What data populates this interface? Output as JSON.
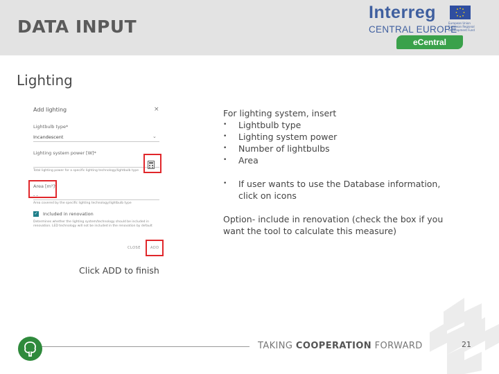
{
  "header": {
    "title": "DATA INPUT",
    "logo": {
      "line1": "Interreg",
      "line2": "CENTRAL EUROPE",
      "eu_text": "European Union European Regional Development Fund",
      "badge": "eCentral"
    }
  },
  "subtitle": "Lighting",
  "dialog": {
    "title": "Add lighting",
    "close_glyph": "×",
    "bulb_type_label": "Lightbulb type*",
    "bulb_type_value": "Incandescent",
    "power_label": "Lighting system power [W]*",
    "power_help": "Total lighting power for a specific lighting technology/lightbulb type",
    "area_label": "Area [m²]*",
    "area_value": "- -",
    "area_help": "Area covered by the specific lighting technology/lightbulb type",
    "include_label": "Included in renovation",
    "include_help": "Determines whether the lighting system/technology should be included in renovation. LED technology will not be included in the renovation by default",
    "close_button": "CLOSE",
    "add_button": "ADD"
  },
  "instructions": {
    "intro": "For lighting system, insert",
    "items": [
      "Lightbulb type",
      "Lighting system power",
      "Number of lightbulbs",
      "Area"
    ],
    "db_note": "If user wants to use the Database information, click on icons",
    "option_note": "Option- include in renovation (check the box if you want the tool to calculate this measure)"
  },
  "finish_note": "Click ADD to finish",
  "footer": {
    "text_pre": "TAKING ",
    "text_bold": "COOPERATION",
    "text_post": " FORWARD",
    "page": "21"
  },
  "colors": {
    "header_band": "#e3e3e3",
    "interreg_blue": "#3f5f9f",
    "ecentral_green": "#3aa14a",
    "highlight_red": "#e0262a",
    "checkbox_teal": "#1f7f8a"
  }
}
